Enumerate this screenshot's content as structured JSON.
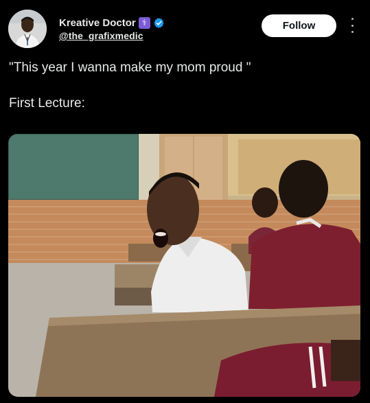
{
  "author": {
    "name": "Kreative Doctor",
    "handle": "@the_grafixmedic",
    "badge_icon": "medical-caduceus-icon",
    "verified_icon": "verified-badge-icon"
  },
  "actions": {
    "follow_label": "Follow",
    "more_icon": "more-vertical-icon"
  },
  "tweet": {
    "line1": "\"This year I wanna make my mom proud \"",
    "line2": "First Lecture:"
  },
  "colors": {
    "background": "#000000",
    "text": "#e7e9ea",
    "follow_bg": "#ffffff",
    "verified": "#1d9bf0",
    "badge": "#7b5cd6"
  }
}
